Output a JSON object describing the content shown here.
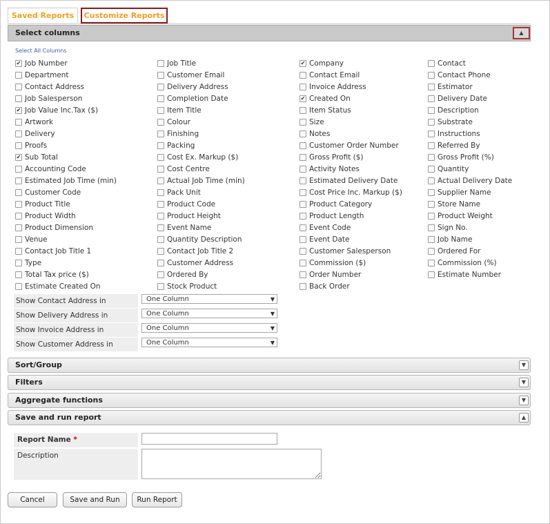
{
  "tabs": {
    "saved": "Saved Reports",
    "customize": "Customize Reports"
  },
  "sections": {
    "select_columns": "Select columns",
    "sort_group": "Sort/Group",
    "filters": "Filters",
    "aggregate": "Aggregate functions",
    "save_run": "Save and run report"
  },
  "select_all": "Select All Columns",
  "columns": [
    [
      {
        "label": "Job Number",
        "checked": true
      },
      {
        "label": "Department",
        "checked": false
      },
      {
        "label": "Contact Address",
        "checked": false
      },
      {
        "label": "Job Salesperson",
        "checked": false
      },
      {
        "label": "Job Value Inc.Tax ($)",
        "checked": true
      },
      {
        "label": "Artwork",
        "checked": false
      },
      {
        "label": "Delivery",
        "checked": false
      },
      {
        "label": "Proofs",
        "checked": false
      },
      {
        "label": "Sub Total",
        "checked": true
      },
      {
        "label": "Accounting Code",
        "checked": false
      },
      {
        "label": "Estimated Job Time (min)",
        "checked": false
      },
      {
        "label": "Customer Code",
        "checked": false
      },
      {
        "label": "Product Title",
        "checked": false
      },
      {
        "label": "Product Width",
        "checked": false
      },
      {
        "label": "Product Dimension",
        "checked": false
      },
      {
        "label": "Venue",
        "checked": false
      },
      {
        "label": "Contact Job Title 1",
        "checked": false
      },
      {
        "label": "Type",
        "checked": false
      },
      {
        "label": "Total Tax price ($)",
        "checked": false
      },
      {
        "label": "Estimate Created On",
        "checked": false
      }
    ],
    [
      {
        "label": "Job Title",
        "checked": false
      },
      {
        "label": "Customer Email",
        "checked": false
      },
      {
        "label": "Delivery Address",
        "checked": false
      },
      {
        "label": "Completion Date",
        "checked": false
      },
      {
        "label": "Item Title",
        "checked": false
      },
      {
        "label": "Colour",
        "checked": false
      },
      {
        "label": "Finishing",
        "checked": false
      },
      {
        "label": "Packing",
        "checked": false
      },
      {
        "label": "Cost Ex. Markup ($)",
        "checked": false
      },
      {
        "label": "Cost Centre",
        "checked": false
      },
      {
        "label": "Actual Job Time (min)",
        "checked": false
      },
      {
        "label": "Pack Unit",
        "checked": false
      },
      {
        "label": "Product Code",
        "checked": false
      },
      {
        "label": "Product Height",
        "checked": false
      },
      {
        "label": "Event Name",
        "checked": false
      },
      {
        "label": "Quantity Description",
        "checked": false
      },
      {
        "label": "Contact Job Title 2",
        "checked": false
      },
      {
        "label": "Customer Address",
        "checked": false
      },
      {
        "label": "Ordered By",
        "checked": false
      },
      {
        "label": "Stock Product",
        "checked": false
      }
    ],
    [
      {
        "label": "Company",
        "checked": true
      },
      {
        "label": "Contact Email",
        "checked": false
      },
      {
        "label": "Invoice Address",
        "checked": false
      },
      {
        "label": "Created On",
        "checked": true
      },
      {
        "label": "Item Status",
        "checked": false
      },
      {
        "label": "Size",
        "checked": false
      },
      {
        "label": "Notes",
        "checked": false
      },
      {
        "label": "Customer Order Number",
        "checked": false
      },
      {
        "label": "Gross Profit ($)",
        "checked": false
      },
      {
        "label": "Activity Notes",
        "checked": false
      },
      {
        "label": "Estimated Delivery Date",
        "checked": false
      },
      {
        "label": "Cost Price Inc. Markup ($)",
        "checked": false
      },
      {
        "label": "Product Category",
        "checked": false
      },
      {
        "label": "Product Length",
        "checked": false
      },
      {
        "label": "Event Code",
        "checked": false
      },
      {
        "label": "Event Date",
        "checked": false
      },
      {
        "label": "Customer Salesperson",
        "checked": false
      },
      {
        "label": "Commission ($)",
        "checked": false
      },
      {
        "label": "Order Number",
        "checked": false
      },
      {
        "label": "Back Order",
        "checked": false
      }
    ],
    [
      {
        "label": "Contact",
        "checked": false
      },
      {
        "label": "Contact Phone",
        "checked": false
      },
      {
        "label": "Estimator",
        "checked": false
      },
      {
        "label": "Delivery Date",
        "checked": false
      },
      {
        "label": "Description",
        "checked": false
      },
      {
        "label": "Substrate",
        "checked": false
      },
      {
        "label": "Instructions",
        "checked": false
      },
      {
        "label": "Referred By",
        "checked": false
      },
      {
        "label": "Gross Profit (%)",
        "checked": false
      },
      {
        "label": "Quantity",
        "checked": false
      },
      {
        "label": "Actual Delivery Date",
        "checked": false
      },
      {
        "label": "Supplier Name",
        "checked": false
      },
      {
        "label": "Store Name",
        "checked": false
      },
      {
        "label": "Product Weight",
        "checked": false
      },
      {
        "label": "Sign No.",
        "checked": false
      },
      {
        "label": "Job Name",
        "checked": false
      },
      {
        "label": "Ordered For",
        "checked": false
      },
      {
        "label": "Commission (%)",
        "checked": false
      },
      {
        "label": "Estimate Number",
        "checked": false
      }
    ]
  ],
  "address_options": [
    {
      "label": "Show Contact Address in",
      "value": "One Column"
    },
    {
      "label": "Show Delivery Address in",
      "value": "One Column"
    },
    {
      "label": "Show Invoice Address in",
      "value": "One Column"
    },
    {
      "label": "Show Customer Address in",
      "value": "One Column"
    }
  ],
  "form": {
    "report_name_label": "Report Name",
    "required_mark": "*",
    "description_label": "Description",
    "report_name_value": "",
    "description_value": ""
  },
  "buttons": {
    "cancel": "Cancel",
    "save_run": "Save and Run",
    "run": "Run Report"
  },
  "icons": {
    "expanded": "chevron-up-icon",
    "collapsed": "chevron-down-icon",
    "select_arrow": "triangle-down-icon"
  },
  "colors": {
    "tab_text": "#f0a020",
    "active_tab_border": "#8a1a1a",
    "required": "#cc0000",
    "link": "#3b5ba8"
  }
}
